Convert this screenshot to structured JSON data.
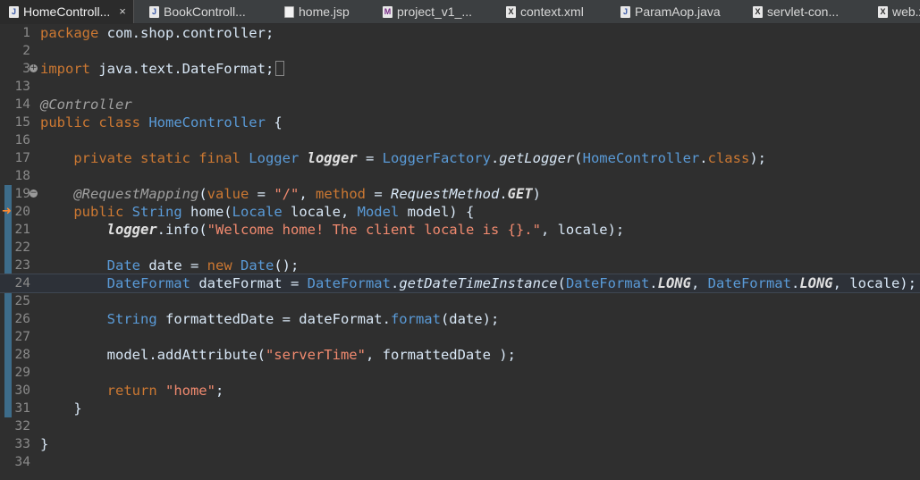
{
  "tabs": [
    {
      "label": "HomeControll...",
      "icon": "java-file-icon",
      "active": true
    },
    {
      "label": "BookControll...",
      "icon": "java-file-icon"
    },
    {
      "label": "home.jsp",
      "icon": "jsp-file-icon"
    },
    {
      "label": "project_v1_...",
      "icon": "maven-file-icon"
    },
    {
      "label": "context.xml",
      "icon": "xml-file-icon"
    },
    {
      "label": "ParamAop.java",
      "icon": "java-file-icon"
    },
    {
      "label": "servlet-con...",
      "icon": "xml-file-icon"
    },
    {
      "label": "web.x",
      "icon": "xml-file-icon"
    }
  ],
  "close_glyph": "×",
  "lines": [
    {
      "n": "1",
      "t": [
        [
          "kw",
          "package "
        ],
        [
          "p",
          "com.shop.controller;"
        ]
      ]
    },
    {
      "n": "2",
      "t": []
    },
    {
      "n": "3",
      "t": [
        [
          "kw",
          "import "
        ],
        [
          "p",
          "java.text.DateFormat;"
        ]
      ]
    },
    {
      "n": "13",
      "t": []
    },
    {
      "n": "14",
      "t": [
        [
          "an",
          "@Controller"
        ]
      ]
    },
    {
      "n": "15",
      "t": [
        [
          "kw",
          "public class "
        ],
        [
          "ty",
          "HomeController"
        ],
        [
          "p",
          " {"
        ]
      ]
    },
    {
      "n": "16",
      "t": []
    },
    {
      "n": "17",
      "t": [
        [
          "p",
          "    "
        ],
        [
          "kw",
          "private static final "
        ],
        [
          "ty",
          "Logger "
        ],
        [
          "fi",
          "logger"
        ],
        [
          "p",
          " = "
        ],
        [
          "ty",
          "LoggerFactory"
        ],
        [
          "p",
          "."
        ],
        [
          "it",
          "getLogger"
        ],
        [
          "p",
          "("
        ],
        [
          "ty",
          "HomeController"
        ],
        [
          "p",
          "."
        ],
        [
          "kw",
          "class"
        ],
        [
          "p",
          ");"
        ]
      ]
    },
    {
      "n": "18",
      "t": []
    },
    {
      "n": "19",
      "t": [
        [
          "p",
          "    "
        ],
        [
          "an",
          "@RequestMapping"
        ],
        [
          "p",
          "("
        ],
        [
          "kw",
          "value"
        ],
        [
          "p",
          " = "
        ],
        [
          "st",
          "\"/\""
        ],
        [
          "p",
          ", "
        ],
        [
          "kw",
          "method"
        ],
        [
          "p",
          " = "
        ],
        [
          "it",
          "RequestMethod"
        ],
        [
          "p",
          "."
        ],
        [
          "fi",
          "GET"
        ],
        [
          "p",
          ")"
        ]
      ]
    },
    {
      "n": "20",
      "t": [
        [
          "p",
          "    "
        ],
        [
          "kw",
          "public "
        ],
        [
          "ty",
          "String "
        ],
        [
          "p",
          "home("
        ],
        [
          "ty",
          "Locale "
        ],
        [
          "p",
          "locale, "
        ],
        [
          "ty",
          "Model "
        ],
        [
          "p",
          "model) {"
        ]
      ]
    },
    {
      "n": "21",
      "t": [
        [
          "p",
          "        "
        ],
        [
          "fi",
          "logger"
        ],
        [
          "p",
          ".info("
        ],
        [
          "st",
          "\"Welcome home! The client locale is {}.\""
        ],
        [
          "p",
          ", locale);"
        ]
      ]
    },
    {
      "n": "22",
      "t": []
    },
    {
      "n": "23",
      "t": [
        [
          "p",
          "        "
        ],
        [
          "ty",
          "Date "
        ],
        [
          "p",
          "date = "
        ],
        [
          "kw",
          "new "
        ],
        [
          "ty",
          "Date"
        ],
        [
          "p",
          "();"
        ]
      ]
    },
    {
      "n": "24",
      "t": [
        [
          "p",
          "        "
        ],
        [
          "ty",
          "DateFormat "
        ],
        [
          "p",
          "dateFormat = "
        ],
        [
          "ty",
          "DateFormat"
        ],
        [
          "p",
          "."
        ],
        [
          "it",
          "getDateTimeInstance"
        ],
        [
          "p",
          "("
        ],
        [
          "ty",
          "DateFormat"
        ],
        [
          "p",
          "."
        ],
        [
          "fi",
          "LONG"
        ],
        [
          "p",
          ", "
        ],
        [
          "ty",
          "DateFormat"
        ],
        [
          "p",
          "."
        ],
        [
          "fi",
          "LONG"
        ],
        [
          "p",
          ", locale);"
        ]
      ]
    },
    {
      "n": "25",
      "t": []
    },
    {
      "n": "26",
      "t": [
        [
          "p",
          "        "
        ],
        [
          "ty",
          "String "
        ],
        [
          "p",
          "formattedDate = dateFormat."
        ],
        [
          "ty",
          "format"
        ],
        [
          "p",
          "(date);"
        ]
      ]
    },
    {
      "n": "27",
      "t": []
    },
    {
      "n": "28",
      "t": [
        [
          "p",
          "        model.addAttribute("
        ],
        [
          "st",
          "\"serverTime\""
        ],
        [
          "p",
          ", formattedDate );"
        ]
      ]
    },
    {
      "n": "29",
      "t": []
    },
    {
      "n": "30",
      "t": [
        [
          "p",
          "        "
        ],
        [
          "kw",
          "return "
        ],
        [
          "st",
          "\"home\""
        ],
        [
          "p",
          ";"
        ]
      ]
    },
    {
      "n": "31",
      "t": [
        [
          "p",
          "    }"
        ]
      ]
    },
    {
      "n": "32",
      "t": []
    },
    {
      "n": "33",
      "t": [
        [
          "p",
          "}"
        ]
      ]
    },
    {
      "n": "34",
      "t": []
    }
  ],
  "current_line": "24",
  "folded_lines": [
    "3"
  ],
  "fold_markers": [
    "3",
    "19"
  ],
  "debug_line": "20",
  "colors": {
    "keyword": "#cc7832",
    "type": "#5a9bd8",
    "string": "#f18a6f",
    "annotation": "#a0a0a0",
    "background": "#2f2f2f"
  }
}
